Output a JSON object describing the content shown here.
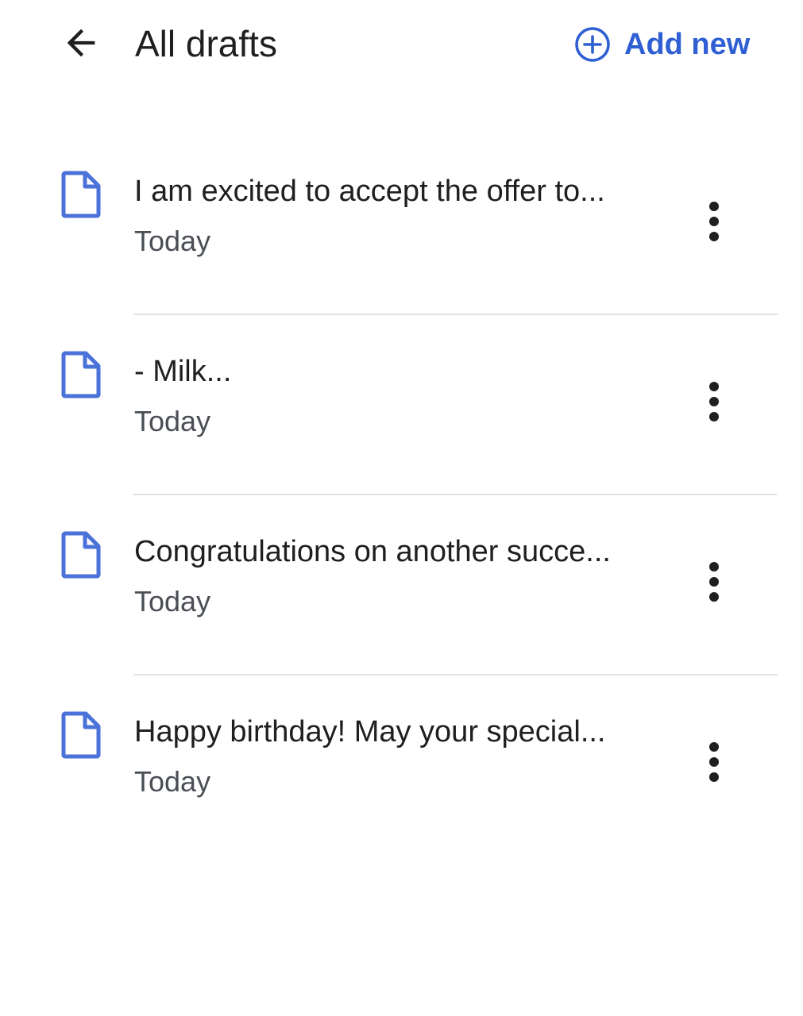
{
  "header": {
    "title": "All drafts",
    "back_icon": "arrow-left-icon",
    "add_new_label": "Add new",
    "add_new_icon": "plus-circle-icon"
  },
  "drafts": [
    {
      "title": "I am excited to accept the offer to...",
      "date": "Today"
    },
    {
      "title": "-  Milk...",
      "date": "Today"
    },
    {
      "title": "Congratulations on another succe...",
      "date": "Today"
    },
    {
      "title": "Happy birthday! May your special...",
      "date": "Today"
    }
  ],
  "colors": {
    "accent": "#2f5fd3",
    "doc_icon": "#4a72d9",
    "text_primary": "#1f1f1f",
    "text_secondary": "#4a4e55",
    "divider": "#e2e3e6"
  },
  "icons": {
    "draft_icon": "document-icon",
    "more_icon": "more-vertical-icon"
  }
}
